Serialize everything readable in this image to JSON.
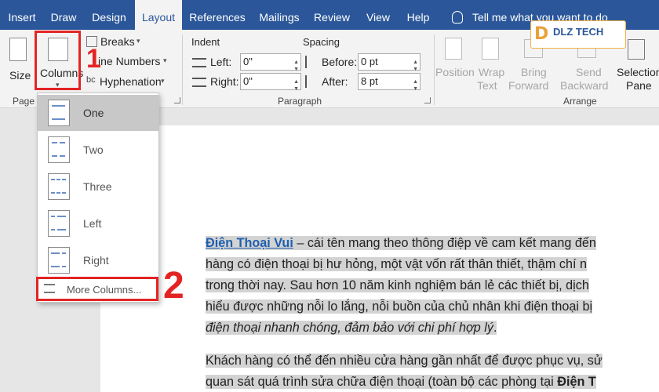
{
  "tabs": [
    {
      "label": "Insert"
    },
    {
      "label": "Draw"
    },
    {
      "label": "Design"
    },
    {
      "label": "Layout"
    },
    {
      "label": "References"
    },
    {
      "label": "Mailings"
    },
    {
      "label": "Review"
    },
    {
      "label": "View"
    },
    {
      "label": "Help"
    }
  ],
  "active_tab": "Layout",
  "tell_me": "Tell me what you want to do",
  "logo": {
    "text": "DLZ TECH",
    "letter": "D"
  },
  "page_setup": {
    "size_label": "Size",
    "columns_label": "Columns",
    "breaks_label": "Breaks",
    "line_numbers_label": "ine Numbers",
    "hyphenation_label": "Hyphenation",
    "group_label": "Page S"
  },
  "paragraph": {
    "indent_label": "Indent",
    "spacing_label": "Spacing",
    "left_label": "Left:",
    "right_label": "Right:",
    "before_label": "Before:",
    "after_label": "After:",
    "left_value": "0\"",
    "right_value": "0\"",
    "before_value": "0 pt",
    "after_value": "8 pt",
    "group_label": "Paragraph"
  },
  "arrange": {
    "position_label": [
      "Position"
    ],
    "wrap_label": [
      "Wrap",
      "Text"
    ],
    "bring_label": [
      "Bring",
      "Forward"
    ],
    "send_label": [
      "Send",
      "Backward"
    ],
    "selection_label": [
      "Selection",
      "Pane"
    ],
    "group_label": "Arrange"
  },
  "columns_menu": {
    "items": [
      {
        "label": "One"
      },
      {
        "label": "Two"
      },
      {
        "label": "Three"
      },
      {
        "label": "Left"
      },
      {
        "label": "Right"
      }
    ],
    "selected": "One",
    "more_label": "More Columns..."
  },
  "annotations": {
    "step1": "1",
    "step2": "2"
  },
  "document": {
    "p1_link": "Điện Thoại Vui",
    "p1_line1": " – cái tên mang theo thông điệp về cam kết mang đến",
    "p1_line2": "hàng có điện thoại bị hư hỏng, một vật vốn rất thân thiết, thậm chí n",
    "p1_line3": "trong thời nay. Sau hơn 10 năm kinh nghiệm bán lẻ các thiết bị, dịch",
    "p1_line4": "hiểu được những nỗi lo lắng, nỗi buồn của chủ nhân khi điện thoại bị",
    "p1_line5": "điện thoại nhanh chóng, đảm bảo với chi phí hợp lý",
    "p1_line5_end": ".",
    "p2_line1": "Khách hàng có thể đến nhiều cửa hàng gần nhất để được phục vụ, sử",
    "p2_line2": "quan sát quá trình sửa chữa điện thoại (toàn bộ các phòng tại ",
    "p2_line2_bold": "Điện T"
  },
  "colors": {
    "ribbon_blue": "#2b579a",
    "annotation_red": "#e32424",
    "selection_grey": "#d3d3d3"
  }
}
